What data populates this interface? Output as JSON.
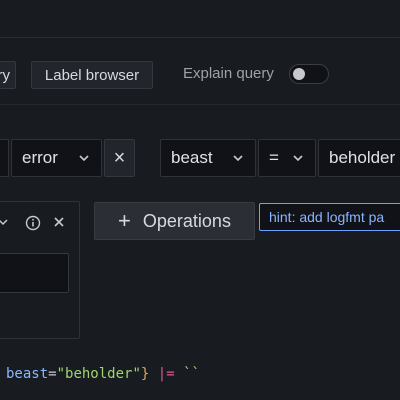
{
  "toolbar": {
    "query_button_label": "ry",
    "label_browser_label": "Label browser",
    "explain_query_label": "Explain query",
    "explain_query_enabled": false
  },
  "label_filter": {
    "value_select": "error",
    "remove_button_label": "×"
  },
  "label_filter_2": {
    "label_select": "beast",
    "operator_select": "=",
    "value_select": "beholder"
  },
  "operations": {
    "button_label": "Operations",
    "hint_text": "hint: add logfmt pa"
  },
  "query_preview": {
    "label_name": "beast",
    "equals": "=",
    "label_value": "\"beholder\"",
    "close_brace": "}",
    "pipe": "|=",
    "backticks": "``"
  },
  "colors": {
    "background": "#111217",
    "panel": "#181b1f",
    "hint_border": "#6e9fff",
    "query_label": "#8ab8ff",
    "query_string": "#9fd572",
    "query_pipe": "#e25698",
    "query_brace": "#e0a660"
  }
}
